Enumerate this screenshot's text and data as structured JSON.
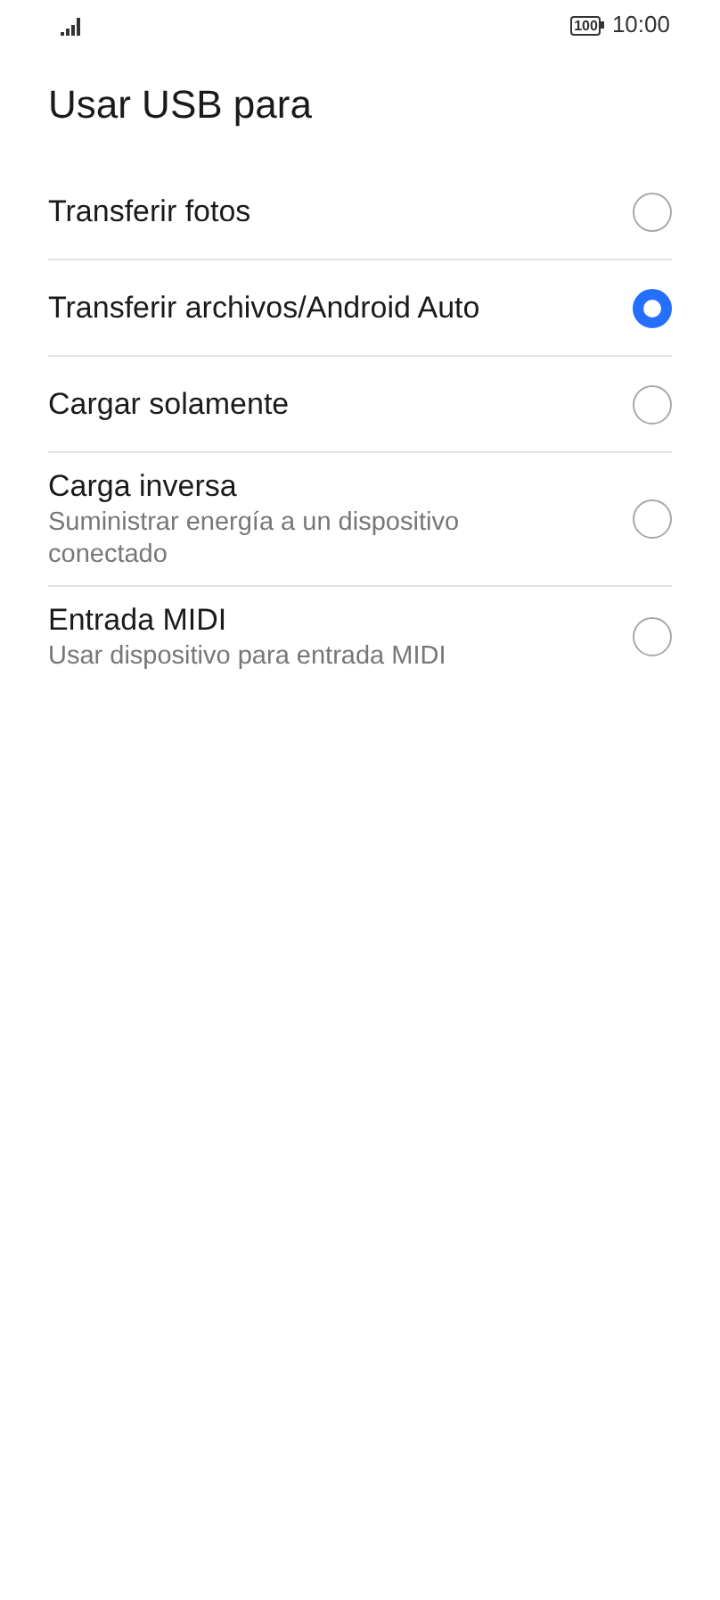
{
  "status_bar": {
    "battery": "100",
    "time": "10:00"
  },
  "title": "Usar USB para",
  "options": [
    {
      "label": "Transferir fotos",
      "selected": false
    },
    {
      "label": "Transferir archivos/Android Auto",
      "selected": true
    },
    {
      "label": "Cargar solamente",
      "selected": false
    },
    {
      "label": "Carga inversa",
      "description": "Suministrar energía a un dispositivo conectado",
      "selected": false
    },
    {
      "label": "Entrada MIDI",
      "description": "Usar dispositivo para entrada MIDI",
      "selected": false
    }
  ]
}
